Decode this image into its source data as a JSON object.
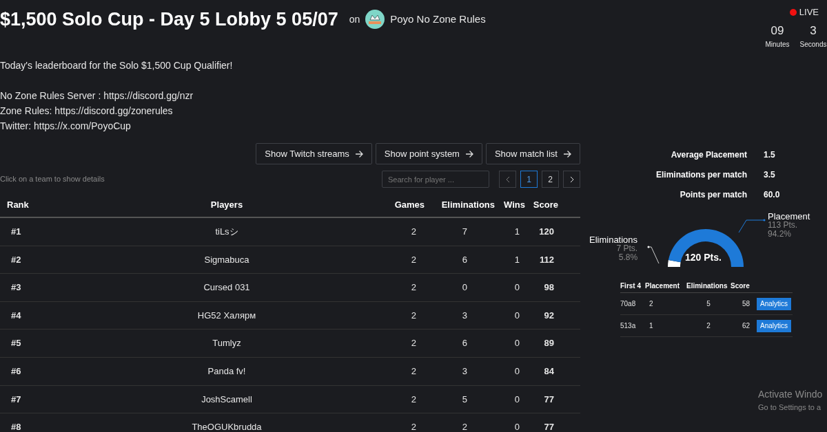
{
  "title": "$1,500 Solo Cup - Day 5 Lobby 5 05/07",
  "on_label": "on",
  "organizer": "Poyo No Zone Rules",
  "live": {
    "label": "LIVE",
    "units": [
      {
        "value": "09",
        "label": "Minutes"
      },
      {
        "value": "3",
        "label": "Seconds"
      }
    ]
  },
  "description": [
    "Today's leaderboard for the Solo $1,500 Cup Qualifier!",
    "No Zone Rules Server : https://discord.gg/nzr",
    "Zone Rules: https://discord.gg/zonerules",
    "Twitter: https://x.com/PoyoCup"
  ],
  "actions": [
    "Show Twitch streams",
    "Show point system",
    "Show match list"
  ],
  "hint": "Click on a team to show details",
  "search": {
    "placeholder": "Search for player ..."
  },
  "pages": [
    {
      "label": "1",
      "selected": true
    },
    {
      "label": "2",
      "selected": false
    }
  ],
  "table": {
    "columns": [
      "Rank",
      "Players",
      "Games",
      "Eliminations",
      "Wins",
      "Score"
    ],
    "rows": [
      [
        "#1",
        "tiLsシ",
        "2",
        "7",
        "1",
        "120"
      ],
      [
        "#2",
        "Sigmabuca",
        "2",
        "6",
        "1",
        "112"
      ],
      [
        "#3",
        "Cursed 031",
        "2",
        "0",
        "0",
        "98"
      ],
      [
        "#4",
        "HG52 Халярм",
        "2",
        "3",
        "0",
        "92"
      ],
      [
        "#5",
        "Tumlyz",
        "2",
        "6",
        "0",
        "89"
      ],
      [
        "#6",
        "Panda fv!",
        "2",
        "3",
        "0",
        "84"
      ],
      [
        "#7",
        "JoshScamell",
        "2",
        "5",
        "0",
        "77"
      ],
      [
        "#8",
        "TheOGUKbrudda",
        "2",
        "2",
        "0",
        "77"
      ]
    ]
  },
  "details": {
    "stats": [
      {
        "label": "Average Placement",
        "value": "1.5"
      },
      {
        "label": "Eliminations per match",
        "value": "3.5"
      },
      {
        "label": "Points per match",
        "value": "60.0"
      }
    ],
    "gauge": {
      "total": "120 Pts.",
      "segments": [
        {
          "name": "Eliminations",
          "points": "7 Pts.",
          "share": "5.8%",
          "color": "#ffffff"
        },
        {
          "name": "Placement",
          "points": "113 Pts.",
          "share": "94.2%",
          "color": "#1e7ad8"
        }
      ]
    },
    "matches": {
      "columns": [
        "First 4",
        "Placement",
        "Eliminations",
        "Score"
      ],
      "rows": [
        {
          "cells": [
            "70a8",
            "2",
            "5",
            "58"
          ],
          "action": "Analytics"
        },
        {
          "cells": [
            "513a",
            "1",
            "2",
            "62"
          ],
          "action": "Analytics"
        }
      ]
    }
  },
  "os_notice": [
    "Activate Windo",
    "Go to Settings to a"
  ]
}
